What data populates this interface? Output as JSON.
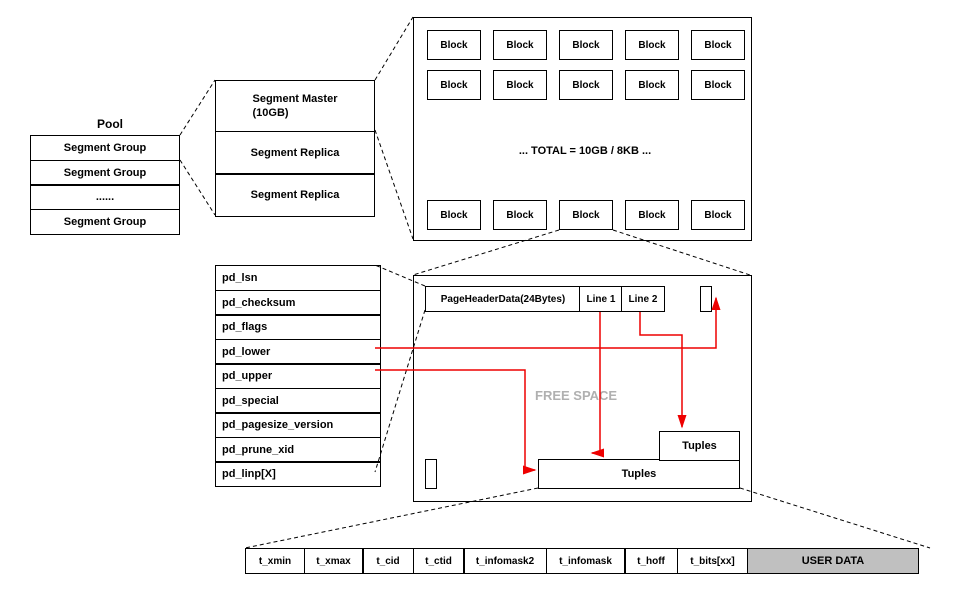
{
  "pool": {
    "title": "Pool",
    "items": [
      "Segment Group",
      "Segment Group",
      "......",
      "Segment Group"
    ]
  },
  "segment": {
    "master": "Segment Master\n(10GB)",
    "replica1": "Segment Replica",
    "replica2": "Segment Replica"
  },
  "blocks": {
    "label": "Block",
    "total": "... TOTAL = 10GB / 8KB ..."
  },
  "pageheader": {
    "fields": [
      "pd_lsn",
      "pd_checksum",
      "pd_flags",
      "pd_lower",
      "pd_upper",
      "pd_special",
      "pd_pagesize_version",
      "pd_prune_xid",
      "pd_linp[X]"
    ]
  },
  "page": {
    "header": "PageHeaderData(24Bytes)",
    "line1": "Line 1",
    "line2": "Line 2",
    "freespace": "FREE SPACE",
    "tuples": "Tuples"
  },
  "tuple": {
    "fields": [
      "t_xmin",
      "t_xmax",
      "t_cid",
      "t_ctid",
      "t_infomask2",
      "t_infomask",
      "t_hoff",
      "t_bits[xx]"
    ],
    "userdata": "USER DATA"
  }
}
